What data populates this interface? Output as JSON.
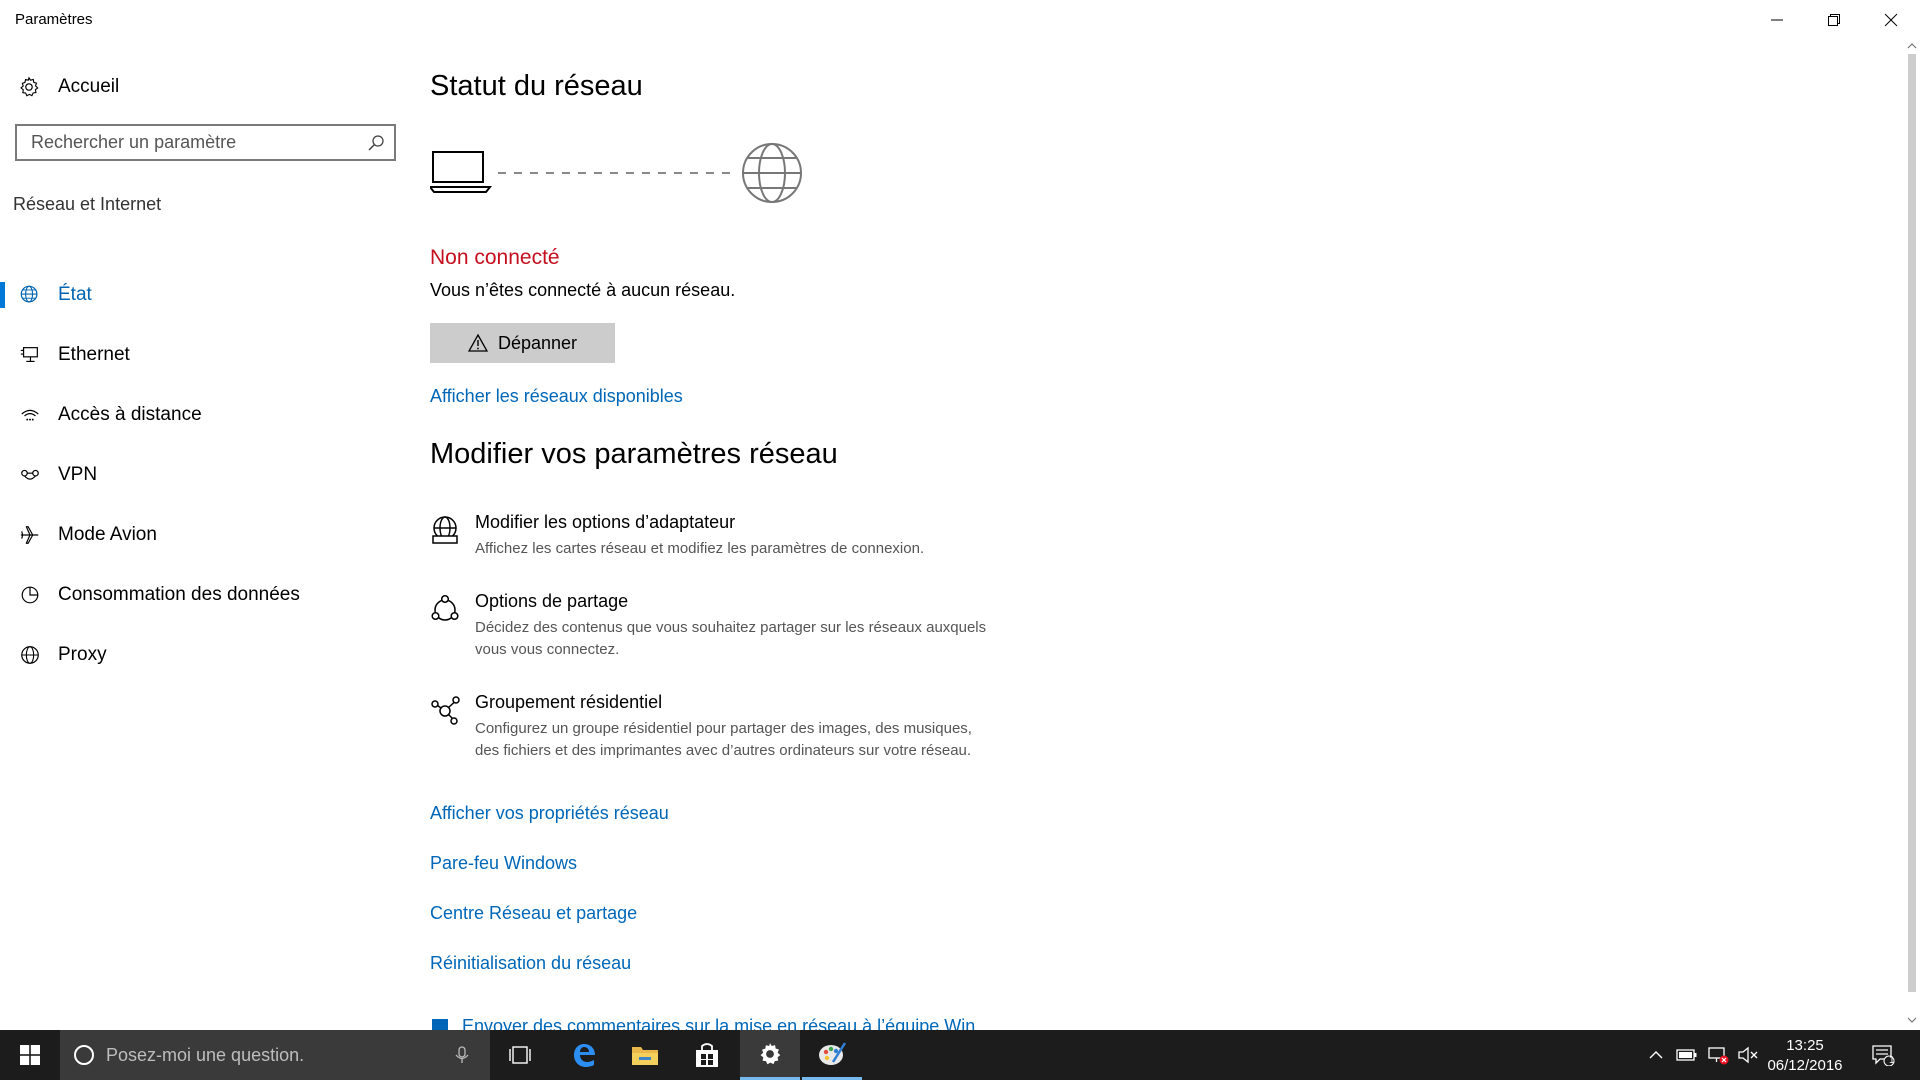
{
  "window": {
    "title": "Paramètres"
  },
  "sidebar": {
    "home_label": "Accueil",
    "search_placeholder": "Rechercher un paramètre",
    "section_title": "Réseau et Internet",
    "items": [
      {
        "label": "État",
        "icon": "globe-network-icon",
        "active": true
      },
      {
        "label": "Ethernet",
        "icon": "ethernet-icon",
        "active": false
      },
      {
        "label": "Accès à distance",
        "icon": "dialup-icon",
        "active": false
      },
      {
        "label": "VPN",
        "icon": "vpn-icon",
        "active": false
      },
      {
        "label": "Mode Avion",
        "icon": "airplane-icon",
        "active": false
      },
      {
        "label": "Consommation des données",
        "icon": "data-usage-icon",
        "active": false
      },
      {
        "label": "Proxy",
        "icon": "globe-icon",
        "active": false
      }
    ]
  },
  "main": {
    "status_heading": "Statut du réseau",
    "status_text": "Non connecté",
    "status_description": "Vous n’êtes connecté à aucun réseau.",
    "troubleshoot_label": "Dépanner",
    "show_networks_link": "Afficher les réseaux disponibles",
    "change_heading": "Modifier vos paramètres réseau",
    "options": [
      {
        "title": "Modifier les options d’adaptateur",
        "description": "Affichez les cartes réseau et modifiez les paramètres de connexion.",
        "icon": "adapter-icon"
      },
      {
        "title": "Options de partage",
        "description": "Décidez des contenus que vous souhaitez partager sur les réseaux auxquels vous vous connectez.",
        "icon": "sharing-icon"
      },
      {
        "title": "Groupement résidentiel",
        "description": "Configurez un groupe résidentiel pour partager des images, des musiques, des fichiers et des imprimantes avec d’autres ordinateurs sur votre réseau.",
        "icon": "homegroup-icon"
      }
    ],
    "links": [
      "Afficher vos propriétés réseau",
      "Pare-feu Windows",
      "Centre Réseau et partage",
      "Réinitialisation du réseau"
    ],
    "feedback_link": "Envoyer des commentaires sur la mise en réseau à l’équipe Win"
  },
  "taskbar": {
    "search_placeholder": "Posez-moi une question.",
    "time": "13:25",
    "date": "06/12/2016",
    "notification_count": "1",
    "accent_color": "#76b9ed"
  },
  "colors": {
    "accent": "#0078d7",
    "link": "#0067b8",
    "error": "#c50f1f"
  }
}
